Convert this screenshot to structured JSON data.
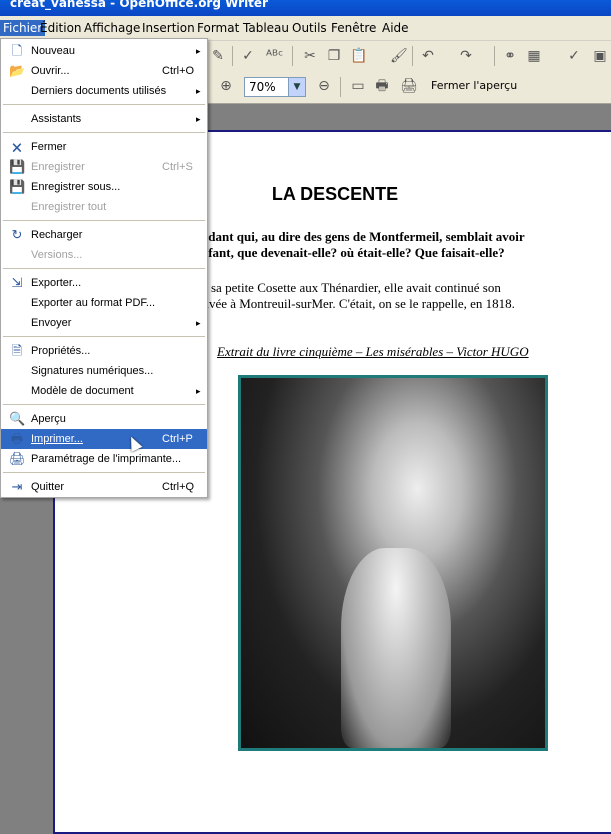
{
  "window": {
    "title": "creat_vanessa - OpenOffice.org Writer"
  },
  "menubar": [
    "Fichier",
    "Édition",
    "Affichage",
    "Insertion",
    "Format",
    "Tableau",
    "Outils",
    "Fenêtre",
    "Aide"
  ],
  "toolbar2": {
    "zoom": "70%",
    "close_preview": "Fermer l'aperçu"
  },
  "file_menu": {
    "items": [
      {
        "label": "Nouveau",
        "icon": "new-doc-icon",
        "submenu": true
      },
      {
        "label": "Ouvrir...",
        "icon": "open-folder-icon",
        "shortcut": "Ctrl+O"
      },
      {
        "label": "Derniers documents utilisés",
        "submenu": true
      },
      {
        "label": "Assistants",
        "submenu": true
      },
      {
        "label": "Fermer",
        "icon": "close-doc-icon"
      },
      {
        "label": "Enregistrer",
        "icon": "save-icon",
        "shortcut": "Ctrl+S",
        "disabled": true
      },
      {
        "label": "Enregistrer sous...",
        "icon": "save-as-icon"
      },
      {
        "label": "Enregistrer tout",
        "disabled": true
      },
      {
        "label": "Recharger",
        "icon": "reload-icon"
      },
      {
        "label": "Versions...",
        "disabled": true
      },
      {
        "label": "Exporter...",
        "icon": "export-icon"
      },
      {
        "label": "Exporter au format PDF..."
      },
      {
        "label": "Envoyer",
        "submenu": true
      },
      {
        "label": "Propriétés...",
        "icon": "properties-icon"
      },
      {
        "label": "Signatures numériques..."
      },
      {
        "label": "Modèle de document",
        "submenu": true
      },
      {
        "label": "Aperçu",
        "icon": "preview-icon",
        "checked": true
      },
      {
        "label": "Imprimer...",
        "icon": "print-icon",
        "shortcut": "Ctrl+P",
        "selected": true
      },
      {
        "label": "Paramétrage de l'imprimante...",
        "icon": "printer-setup-icon"
      },
      {
        "label": "Quitter",
        "icon": "exit-icon",
        "shortcut": "Ctrl+Q"
      }
    ]
  },
  "document": {
    "title": "LA DESCENTE",
    "bold_line1": "ndant qui, au dire des gens de Montfermeil, semblait avoir",
    "bold_line2": "nfant, que devenait-elle? où était-elle? Que faisait-elle?",
    "line3": "sa petite Cosette aux Thénardier, elle avait continué son",
    "line4": "rivée à Montreuil-surMer. C'était, on se le rappelle, en 1818.",
    "caption": "Extrait du livre cinquième – Les misérables – Victor HUGO"
  }
}
